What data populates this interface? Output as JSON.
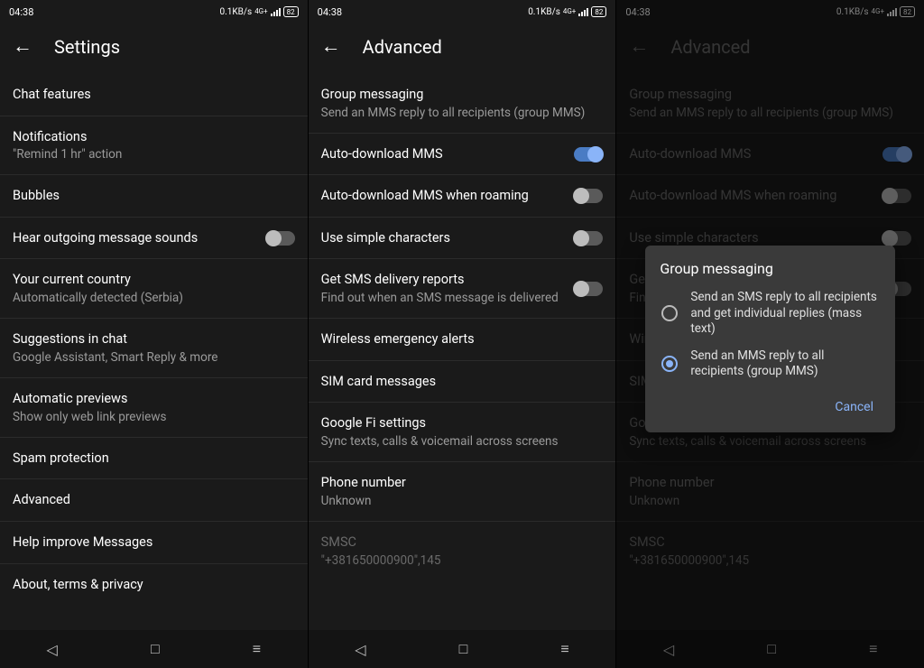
{
  "status": {
    "time": "04:38",
    "net": "0.1KB/s",
    "netgen": "4G+",
    "battery": "82"
  },
  "screen1": {
    "title": "Settings",
    "items": [
      {
        "title": "Chat features"
      },
      {
        "title": "Notifications",
        "sub": "\"Remind 1 hr\" action"
      },
      {
        "title": "Bubbles"
      },
      {
        "title": "Hear outgoing message sounds",
        "toggle": "off"
      },
      {
        "title": "Your current country",
        "sub": "Automatically detected (Serbia)"
      },
      {
        "title": "Suggestions in chat",
        "sub": "Google Assistant, Smart Reply & more"
      },
      {
        "title": "Automatic previews",
        "sub": "Show only web link previews"
      },
      {
        "title": "Spam protection"
      },
      {
        "title": "Advanced"
      },
      {
        "title": "Help improve Messages"
      },
      {
        "title": "About, terms & privacy"
      }
    ]
  },
  "screen2": {
    "title": "Advanced",
    "items": [
      {
        "title": "Group messaging",
        "sub": "Send an MMS reply to all recipients (group MMS)"
      },
      {
        "title": "Auto-download MMS",
        "toggle": "on"
      },
      {
        "title": "Auto-download MMS when roaming",
        "toggle": "off"
      },
      {
        "title": "Use simple characters",
        "toggle": "off"
      },
      {
        "title": "Get SMS delivery reports",
        "sub": "Find out when an SMS message is delivered",
        "toggle": "off"
      },
      {
        "title": "Wireless emergency alerts"
      },
      {
        "title": "SIM card messages"
      },
      {
        "title": "Google Fi settings",
        "sub": "Sync texts, calls & voicemail across screens"
      },
      {
        "title": "Phone number",
        "sub": "Unknown"
      },
      {
        "title": "SMSC",
        "sub": "\"+381650000900\",145",
        "faded": true
      }
    ]
  },
  "screen3": {
    "title": "Advanced",
    "items": [
      {
        "title": "Group messaging",
        "sub": "Send an MMS reply to all recipients (group MMS)"
      },
      {
        "title": "Auto-download MMS",
        "toggle": "on"
      },
      {
        "title": "Auto-download MMS when roaming",
        "toggle": "off"
      },
      {
        "title": "Use simple characters",
        "toggle": "off"
      },
      {
        "title": "Get SMS delivery reports",
        "sub": "Find out when an SMS message is delivered",
        "toggle": "off"
      },
      {
        "title": "Wireless emergency alerts"
      },
      {
        "title": "SIM card messages"
      },
      {
        "title": "Google Fi settings",
        "sub": "Sync texts, calls & voicemail across screens"
      },
      {
        "title": "Phone number",
        "sub": "Unknown"
      },
      {
        "title": "SMSC",
        "sub": "\"+381650000900\",145",
        "faded": true
      }
    ],
    "dialog": {
      "title": "Group messaging",
      "options": [
        {
          "text": "Send an SMS reply to all recipients and get individual replies (mass text)",
          "selected": false
        },
        {
          "text": "Send an MMS reply to all recipients (group MMS)",
          "selected": true
        }
      ],
      "cancel": "Cancel"
    }
  }
}
